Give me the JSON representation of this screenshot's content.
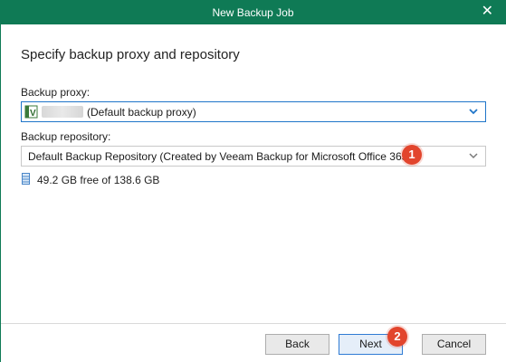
{
  "window": {
    "title": "New Backup Job",
    "close_glyph": "✕"
  },
  "page": {
    "heading": "Specify backup proxy and repository"
  },
  "proxy": {
    "label": "Backup proxy:",
    "value": "(Default backup proxy)",
    "icon": "server-icon"
  },
  "repository": {
    "label": "Backup repository:",
    "value": "Default Backup Repository (Created by Veeam Backup for Microsoft Office 365)",
    "free_space": "49.2 GB free of 138.6 GB",
    "icon": "storage-icon"
  },
  "annotations": {
    "step1": "1",
    "step2": "2",
    "color": "#e2452d"
  },
  "buttons": {
    "back": "Back",
    "next": "Next",
    "cancel": "Cancel"
  },
  "colors": {
    "titlebar": "#0f7a55",
    "focus_border": "#1f75c9"
  }
}
